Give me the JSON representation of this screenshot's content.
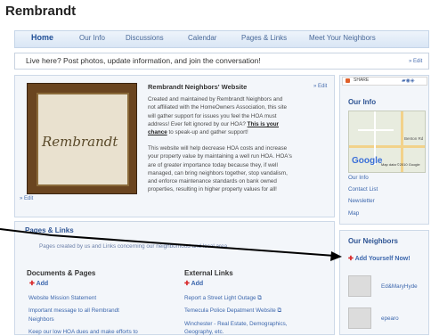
{
  "site": {
    "title": "Rembrandt"
  },
  "nav": {
    "items": [
      "Home",
      "Our Info",
      "Discussions",
      "Calendar",
      "Pages & Links",
      "Meet Your Neighbors"
    ]
  },
  "banner": {
    "text": "Live here? Post photos, update information, and join the conversation!",
    "edit": "» Edit"
  },
  "welcome": {
    "title": "Rembrandt Neighbors' Website",
    "edit": "» Edit",
    "photo_caption": "Rembrandt",
    "para1_lines": [
      "Created and maintained by Rembrandt Neighbors and",
      "not affiliated with the HomeOwners Association, this site",
      "will gather support for issues you feel the HOA must",
      "address! Ever felt ignored by our HOA?"
    ],
    "para1_bold": "This is your",
    "para1_bold2": "chance",
    "para1_end": "to speak-up and gather support!",
    "para2_lines": [
      "This website will help decrease HOA costs and increase",
      "your property value by maintaining a well run HOA. HOA's",
      "are of greater importance today because they, if well",
      "managed, can bring neighbors together, stop vandalism,",
      "and enforce maintenance standards on bank owned",
      "properties, resulting in higher property values for all!"
    ],
    "bottom_edit": "» Edit"
  },
  "pages_links": {
    "title": "Pages & Links",
    "subtitle": "Pages created by us and Links concerning our neighborhood and local area",
    "documents": {
      "title": "Documents & Pages",
      "add": "Add",
      "items": [
        "Website Mission Statement",
        "Important message to all Rembrandt",
        "Neighbors",
        "Keep our low HOA dues and make efforts to"
      ]
    },
    "external": {
      "title": "External Links",
      "add": "Add",
      "items": [
        "Report a Street Light Outage",
        "Temecula Police Depatment Website",
        "Winchester - Real Estate, Demographics,",
        "Geography, etc."
      ]
    }
  },
  "share": {
    "label": "SHARE"
  },
  "our_info": {
    "title": "Our Info",
    "map_labels": [
      "Benton Rd",
      "Google",
      "Map data ©2010 Google"
    ],
    "links": [
      "Our Info",
      "Contact List",
      "Newsletter",
      "Map"
    ]
  },
  "neighbors": {
    "title": "Our Neighbors",
    "add": "Add Yourself Now!",
    "people": [
      "Ed&MaryHyde",
      "epearo"
    ]
  },
  "colors": {
    "link": "#3c67ad",
    "header_blue": "#2f5594",
    "add_red": "#d8282a"
  }
}
